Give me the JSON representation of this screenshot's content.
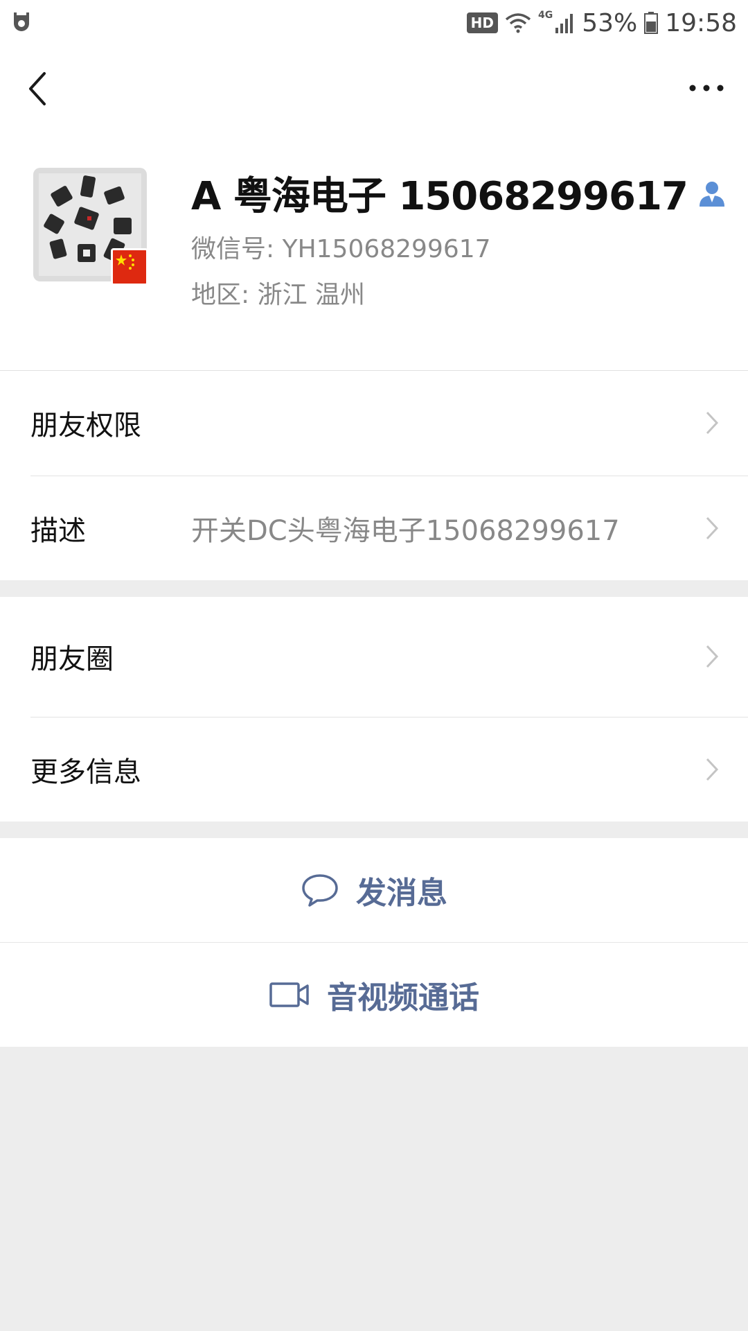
{
  "status_bar": {
    "hd": "HD",
    "network": "4G",
    "battery_pct": "53%",
    "time": "19:58"
  },
  "header": {
    "back_icon": "chevron-left-icon",
    "more_icon": "more-dots-icon"
  },
  "profile": {
    "name": "A 粤海电子 15068299617",
    "wechat_id": "微信号:  YH15068299617",
    "region": "地区:  浙江  温州"
  },
  "group1": {
    "friend_permissions": "朋友权限",
    "description_label": "描述",
    "description_value": "开关DC头粤海电子15068299617"
  },
  "group2": {
    "moments": "朋友圈",
    "more_info": "更多信息"
  },
  "actions": {
    "send_message": "发消息",
    "av_call": "音视频通话"
  },
  "colors": {
    "link_blue": "#576b95",
    "background": "#ededed",
    "contact_icon": "#5b8fd6"
  }
}
